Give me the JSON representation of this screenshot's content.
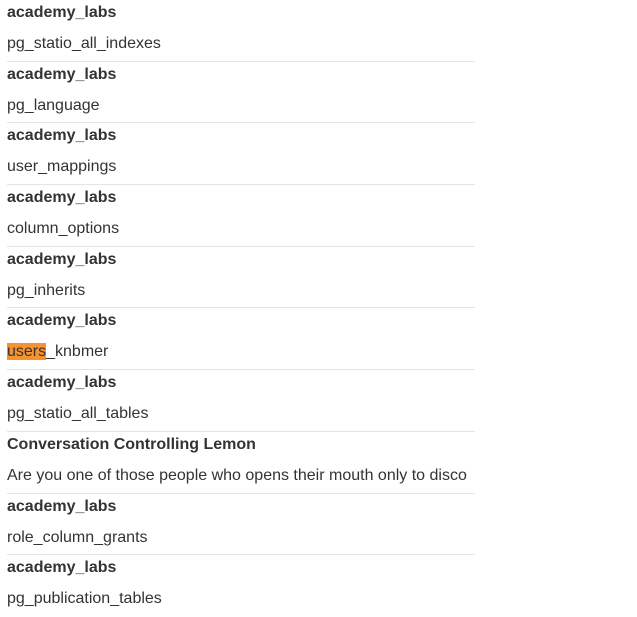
{
  "results": [
    {
      "title": "academy_labs",
      "content": "pg_statio_all_indexes"
    },
    {
      "title": "academy_labs",
      "content": "pg_language"
    },
    {
      "title": "academy_labs",
      "content": "user_mappings"
    },
    {
      "title": "academy_labs",
      "content": "column_options"
    },
    {
      "title": "academy_labs",
      "content": "pg_inherits"
    },
    {
      "title": "academy_labs",
      "content_highlight": "users",
      "content_rest": "_knbmer"
    },
    {
      "title": "academy_labs",
      "content": "pg_statio_all_tables"
    },
    {
      "title": "Conversation Controlling Lemon",
      "content": "Are you one of those people who opens their mouth only to disco"
    },
    {
      "title": "academy_labs",
      "content": "role_column_grants"
    },
    {
      "title": "academy_labs",
      "content": "pg_publication_tables"
    }
  ],
  "colors": {
    "highlight": "#f7922e",
    "text": "#333333",
    "divider": "#e4e4e4"
  }
}
